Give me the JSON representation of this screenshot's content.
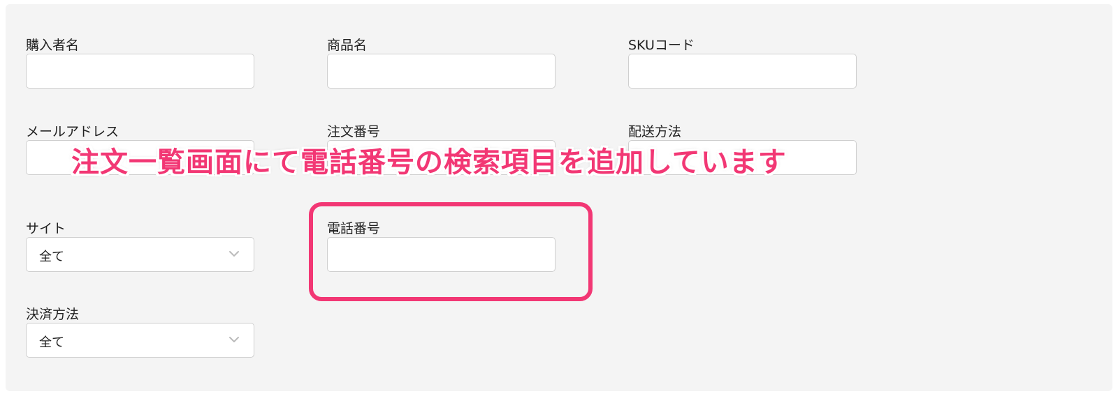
{
  "fields": {
    "buyer_name": {
      "label": "購入者名",
      "value": ""
    },
    "product_name": {
      "label": "商品名",
      "value": ""
    },
    "sku_code": {
      "label": "SKUコード",
      "value": ""
    },
    "email": {
      "label": "メールアドレス",
      "value": ""
    },
    "order_number": {
      "label": "注文番号",
      "value": ""
    },
    "shipping_method": {
      "label": "配送方法",
      "value": ""
    },
    "site": {
      "label": "サイト",
      "selected": "全て"
    },
    "phone_number": {
      "label": "電話番号",
      "value": ""
    },
    "payment_method": {
      "label": "決済方法",
      "selected": "全て"
    }
  },
  "annotation": {
    "text": "注文一覧画面にて電話番号の検索項目を追加しています",
    "color": "#f23774"
  },
  "icons": {
    "select_chevron": "chevron-down-icon"
  }
}
